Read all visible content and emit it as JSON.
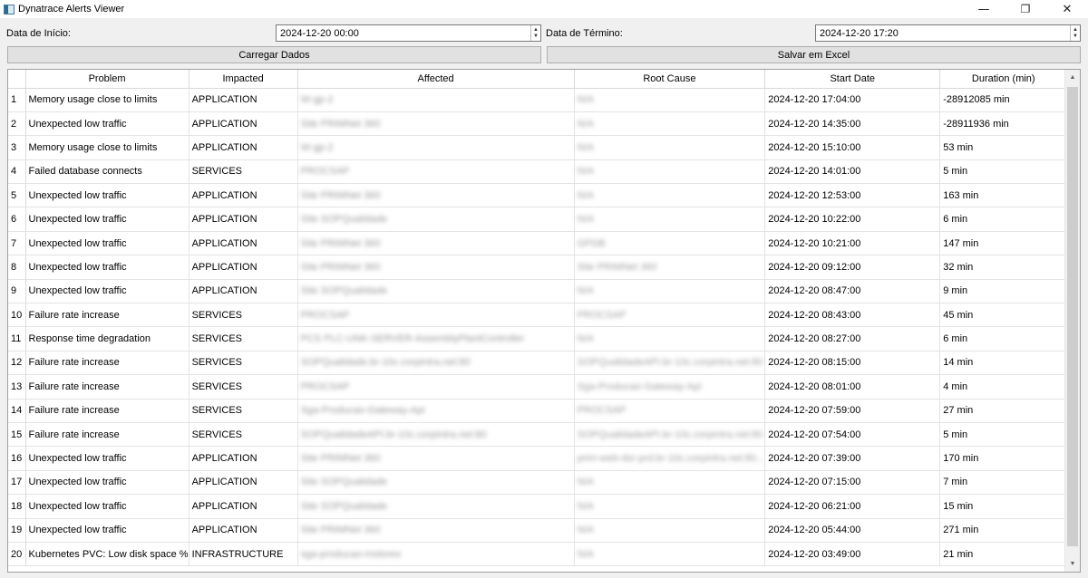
{
  "window": {
    "title": "Dynatrace Alerts Viewer",
    "minimize_glyph": "—",
    "restore_glyph": "❐",
    "close_glyph": "✕"
  },
  "form": {
    "start_label": "Data de Início:",
    "start_value": "2024-12-20 00:00",
    "end_label": "Data de Término:",
    "end_value": "2024-12-20 17:20",
    "load_button": "Carregar Dados",
    "save_button": "Salvar em Excel"
  },
  "table": {
    "headers": [
      "Problem",
      "Impacted",
      "Affected",
      "Root Cause",
      "Start Date",
      "Duration (min)"
    ],
    "rows": [
      {
        "n": "1",
        "problem": "Memory usage close to limits",
        "impacted": "APPLICATION",
        "affected": "W-gp-2",
        "root_cause": "N/A",
        "start": "2024-12-20 17:04:00",
        "duration": "-28912085 min"
      },
      {
        "n": "2",
        "problem": "Unexpected low traffic",
        "impacted": "APPLICATION",
        "affected": "Site PRIMNet 360",
        "root_cause": "N/A",
        "start": "2024-12-20 14:35:00",
        "duration": "-28911936 min"
      },
      {
        "n": "3",
        "problem": "Memory usage close to limits",
        "impacted": "APPLICATION",
        "affected": "W-gp-2",
        "root_cause": "N/A",
        "start": "2024-12-20 15:10:00",
        "duration": "53 min"
      },
      {
        "n": "4",
        "problem": "Failed database connects",
        "impacted": "SERVICES",
        "affected": "PROCSAP",
        "root_cause": "N/A",
        "start": "2024-12-20 14:01:00",
        "duration": "5 min"
      },
      {
        "n": "5",
        "problem": "Unexpected low traffic",
        "impacted": "APPLICATION",
        "affected": "Site PRIMNet 360",
        "root_cause": "N/A",
        "start": "2024-12-20 12:53:00",
        "duration": "163 min"
      },
      {
        "n": "6",
        "problem": "Unexpected low traffic",
        "impacted": "APPLICATION",
        "affected": "Site SOPQualidade",
        "root_cause": "N/A",
        "start": "2024-12-20 10:22:00",
        "duration": "6 min"
      },
      {
        "n": "7",
        "problem": "Unexpected low traffic",
        "impacted": "APPLICATION",
        "affected": "Site PRIMNet 360",
        "root_cause": "GPDB",
        "start": "2024-12-20 10:21:00",
        "duration": "147 min"
      },
      {
        "n": "8",
        "problem": "Unexpected low traffic",
        "impacted": "APPLICATION",
        "affected": "Site PRIMNet 360",
        "root_cause": "Site PRIMNet 360",
        "start": "2024-12-20 09:12:00",
        "duration": "32 min"
      },
      {
        "n": "9",
        "problem": "Unexpected low traffic",
        "impacted": "APPLICATION",
        "affected": "Site SOPQualidade",
        "root_cause": "N/A",
        "start": "2024-12-20 08:47:00",
        "duration": "9 min"
      },
      {
        "n": "10",
        "problem": "Failure rate increase",
        "impacted": "SERVICES",
        "affected": "PROCSAP",
        "root_cause": "PROCSAP",
        "start": "2024-12-20 08:43:00",
        "duration": "45 min"
      },
      {
        "n": "11",
        "problem": "Response time degradation",
        "impacted": "SERVICES",
        "affected": "PCS PLC-UNK-SERVER-AssemblyPlantController",
        "root_cause": "N/A",
        "start": "2024-12-20 08:27:00",
        "duration": "6 min"
      },
      {
        "n": "12",
        "problem": "Failure rate increase",
        "impacted": "SERVICES",
        "affected": "SOPQualidade.br-10c.corpintra.net:80",
        "root_cause": "SOPQualidadeAPI.br-10c.corpintra.net:80",
        "start": "2024-12-20 08:15:00",
        "duration": "14 min"
      },
      {
        "n": "13",
        "problem": "Failure rate increase",
        "impacted": "SERVICES",
        "affected": "PROCSAP",
        "root_cause": "Sga-Producao-Gateway-Api",
        "start": "2024-12-20 08:01:00",
        "duration": "4 min"
      },
      {
        "n": "14",
        "problem": "Failure rate increase",
        "impacted": "SERVICES",
        "affected": "Sga-Producao-Gateway-Api",
        "root_cause": "PROCSAP",
        "start": "2024-12-20 07:59:00",
        "duration": "27 min"
      },
      {
        "n": "15",
        "problem": "Failure rate increase",
        "impacted": "SERVICES",
        "affected": "SOPQualidadeAPI.br-10c.corpintra.net:80",
        "root_cause": "SOPQualidadeAPI.br-10c.corpintra.net:80",
        "start": "2024-12-20 07:54:00",
        "duration": "5 min"
      },
      {
        "n": "16",
        "problem": "Unexpected low traffic",
        "impacted": "APPLICATION",
        "affected": "Site PRIMNet 360",
        "root_cause": "prim-web-dsr-prd.br-10c.corpintra.net:80...",
        "start": "2024-12-20 07:39:00",
        "duration": "170 min"
      },
      {
        "n": "17",
        "problem": "Unexpected low traffic",
        "impacted": "APPLICATION",
        "affected": "Site SOPQualidade",
        "root_cause": "N/A",
        "start": "2024-12-20 07:15:00",
        "duration": "7 min"
      },
      {
        "n": "18",
        "problem": "Unexpected low traffic",
        "impacted": "APPLICATION",
        "affected": "Site SOPQualidade",
        "root_cause": "N/A",
        "start": "2024-12-20 06:21:00",
        "duration": "15 min"
      },
      {
        "n": "19",
        "problem": "Unexpected low traffic",
        "impacted": "APPLICATION",
        "affected": "Site PRIMNet 360",
        "root_cause": "N/A",
        "start": "2024-12-20 05:44:00",
        "duration": "271 min"
      },
      {
        "n": "20",
        "problem": "Kubernetes PVC: Low disk space %",
        "impacted": "INFRASTRUCTURE",
        "affected": "sga-producao-motores",
        "root_cause": "N/A",
        "start": "2024-12-20 03:49:00",
        "duration": "21 min"
      }
    ]
  },
  "scrollbar": {
    "up_glyph": "▲",
    "down_glyph": "▼"
  }
}
